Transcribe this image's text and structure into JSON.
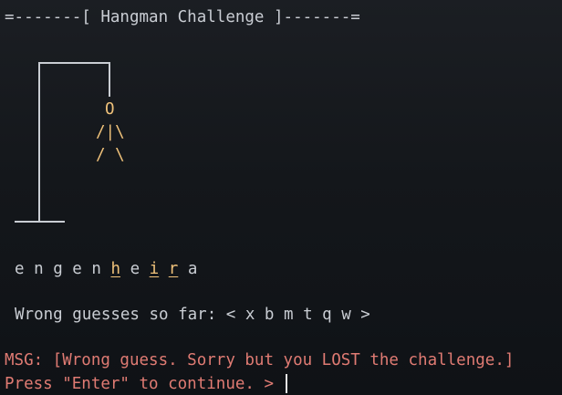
{
  "title": "=-------[ Hangman Challenge ]-------=",
  "figure": {
    "head": "O",
    "body": "/|\\",
    "legs": "/ \\"
  },
  "word": {
    "letters": [
      "e",
      "n",
      "g",
      "e",
      "n",
      "h",
      "e",
      "i",
      "r",
      "a"
    ],
    "highlighted": [
      5,
      7,
      8
    ]
  },
  "wrong_guesses_text": "Wrong guesses so far: < x b m t q w >",
  "message": "MSG: [Wrong guess. Sorry but you LOST the challenge.]",
  "prompt": "Press \"Enter\" to continue. >",
  "colors": {
    "background": "#14171b",
    "text": "#c9cdd3",
    "figure": "#f0c27a",
    "message": "#e07b73"
  }
}
